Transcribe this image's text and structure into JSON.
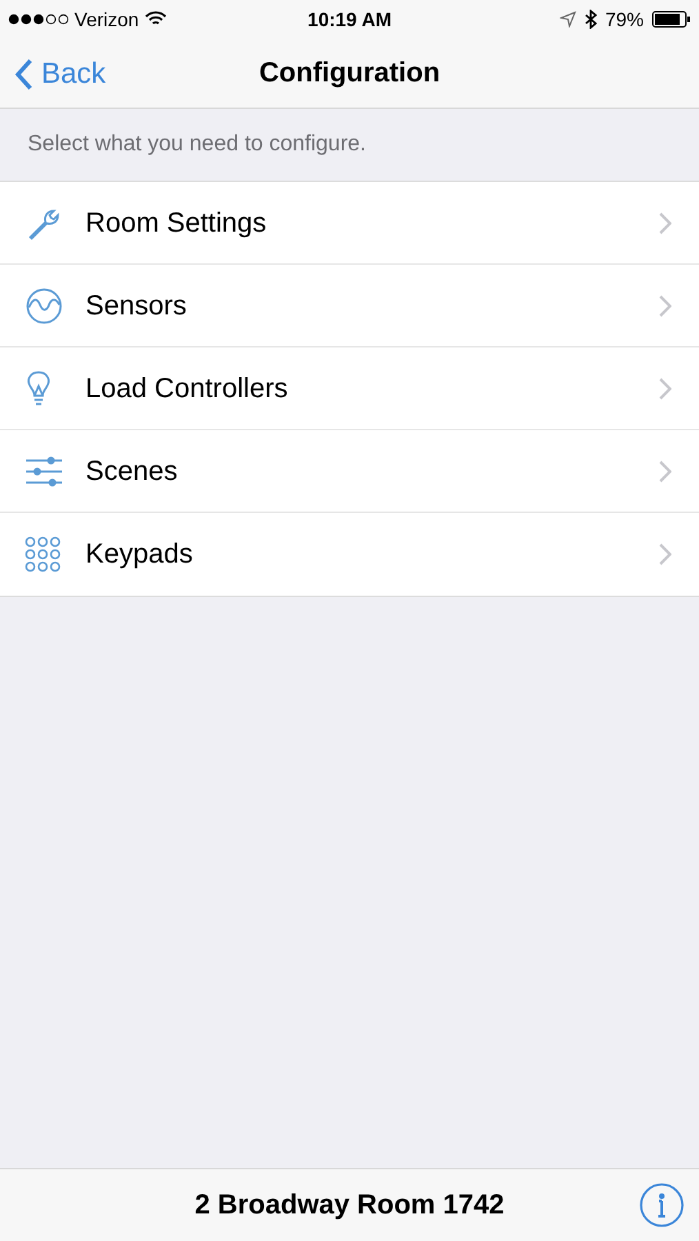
{
  "status_bar": {
    "carrier": "Verizon",
    "time": "10:19 AM",
    "battery": "79%"
  },
  "nav": {
    "back": "Back",
    "title": "Configuration"
  },
  "section_header": "Select what you need to configure.",
  "items": [
    {
      "label": "Room Settings",
      "kind": "wrench"
    },
    {
      "label": "Sensors",
      "kind": "sensor"
    },
    {
      "label": "Load Controllers",
      "kind": "bulb"
    },
    {
      "label": "Scenes",
      "kind": "sliders"
    },
    {
      "label": "Keypads",
      "kind": "keypad"
    }
  ],
  "footer": {
    "title": "2 Broadway Room 1742"
  }
}
